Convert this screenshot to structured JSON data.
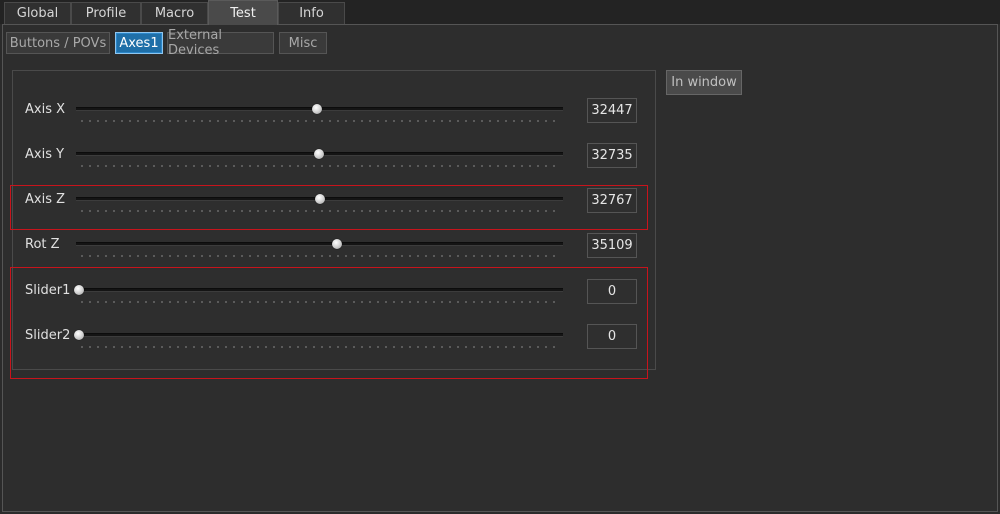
{
  "top_tabs": [
    {
      "label": "Global"
    },
    {
      "label": "Profile"
    },
    {
      "label": "Macro"
    },
    {
      "label": "Test",
      "active": true
    },
    {
      "label": "Info"
    }
  ],
  "sub_tabs": [
    {
      "label": "Buttons / POVs"
    },
    {
      "label": "Axes1",
      "active": true
    },
    {
      "label": "External Devices"
    },
    {
      "label": "Misc"
    }
  ],
  "in_window_button": "In window",
  "axes": [
    {
      "label": "Axis X",
      "value": "32447",
      "level": 0.495
    },
    {
      "label": "Axis Y",
      "value": "32735",
      "level": 0.499
    },
    {
      "label": "Axis Z",
      "value": "32767",
      "level": 0.5
    },
    {
      "label": "Rot Z",
      "value": "35109",
      "level": 0.536
    },
    {
      "label": "Slider1",
      "value": "0",
      "level": 0.0
    },
    {
      "label": "Slider2",
      "value": "0",
      "level": 0.0
    }
  ],
  "highlight_color": "#c8141c",
  "accent_color": "#1f6fa8"
}
